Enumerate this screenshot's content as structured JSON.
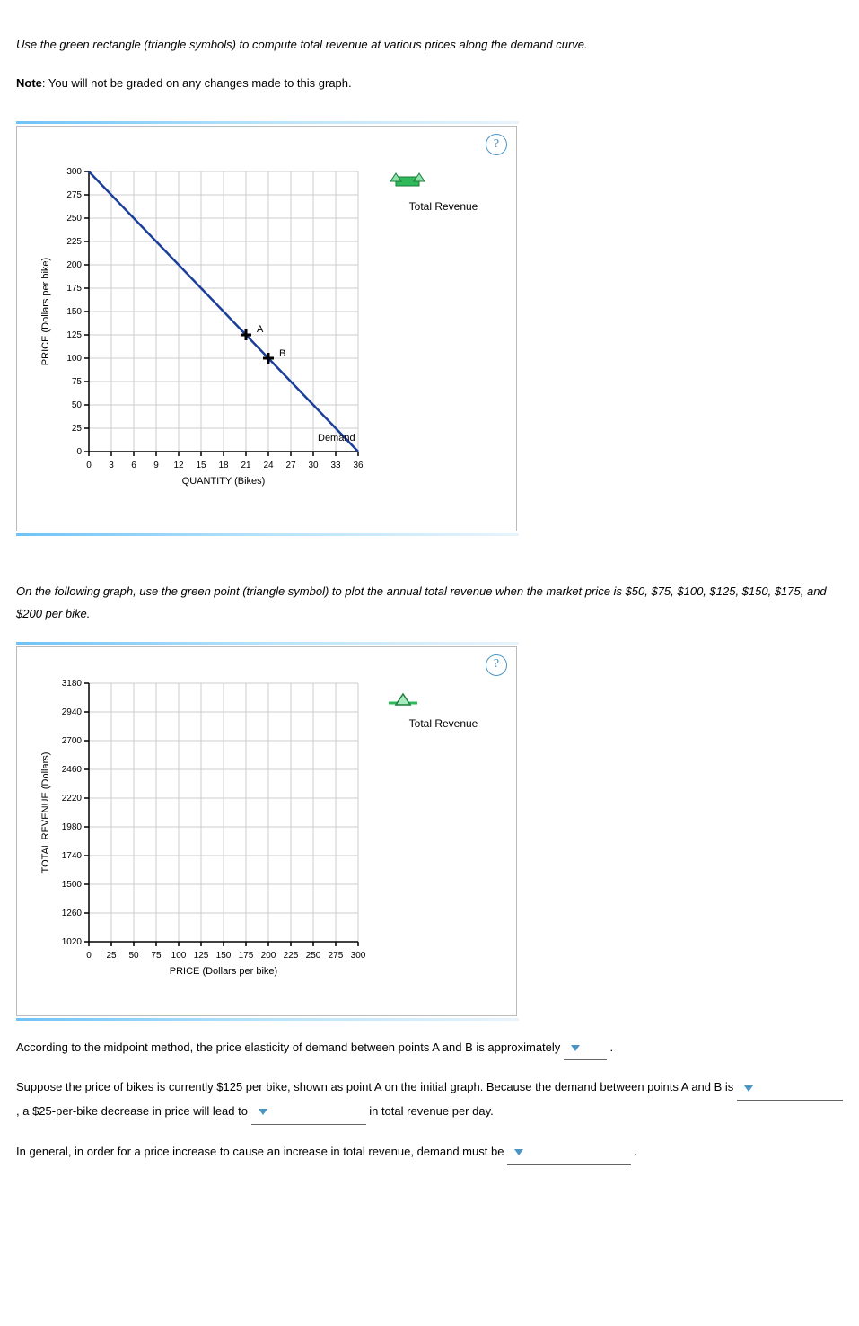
{
  "intro1": "Use the green rectangle (triangle symbols) to compute total revenue at various prices along the demand curve.",
  "intro2a": "Note",
  "intro2b": ": You will not be graded on any changes made to this graph.",
  "help_glyph": "?",
  "legend1": "Total Revenue",
  "legend2": "Total Revenue",
  "chart_data": [
    {
      "type": "line",
      "title": "",
      "xlabel": "QUANTITY (Bikes)",
      "ylabel": "PRICE (Dollars per bike)",
      "xlim": [
        0,
        36
      ],
      "ylim": [
        0,
        300
      ],
      "xticks": [
        0,
        3,
        6,
        9,
        12,
        15,
        18,
        21,
        24,
        27,
        30,
        33,
        36
      ],
      "yticks": [
        0,
        25,
        50,
        75,
        100,
        125,
        150,
        175,
        200,
        225,
        250,
        275,
        300
      ],
      "series": [
        {
          "name": "Demand",
          "color": "#1b3e9a",
          "x": [
            0,
            36
          ],
          "y": [
            300,
            0
          ]
        }
      ],
      "points": [
        {
          "name": "A",
          "x": 21,
          "y": 125
        },
        {
          "name": "B",
          "x": 24,
          "y": 100
        }
      ],
      "annotations": [
        "Demand"
      ]
    },
    {
      "type": "scatter",
      "title": "",
      "xlabel": "PRICE (Dollars per bike)",
      "ylabel": "TOTAL REVENUE (Dollars)",
      "xlim": [
        0,
        300
      ],
      "ylim": [
        1020,
        3180
      ],
      "xticks": [
        0,
        25,
        50,
        75,
        100,
        125,
        150,
        175,
        200,
        225,
        250,
        275,
        300
      ],
      "yticks": [
        1020,
        1260,
        1500,
        1740,
        1980,
        2220,
        2460,
        2700,
        2940,
        3180
      ],
      "series": [],
      "points": []
    }
  ],
  "mid1": "On the following graph, use the green point (triangle symbol) to plot the annual total revenue when the market price is $50, $75, $100, $125, $150, $175, and $200 per bike.",
  "q1a": "According to the midpoint method, the price elasticity of demand between points A and B is approximately ",
  "q1b": " .",
  "q2a": "Suppose the price of bikes is currently $125 per bike, shown as point A on the initial graph. Because the demand between points A and B is ",
  "q2b": " , a $25-per-bike decrease in price will lead to ",
  "q2c": " in total revenue per day.",
  "q3a": "In general, in order for a price increase to cause an increase in total revenue, demand must be ",
  "q3b": " ."
}
